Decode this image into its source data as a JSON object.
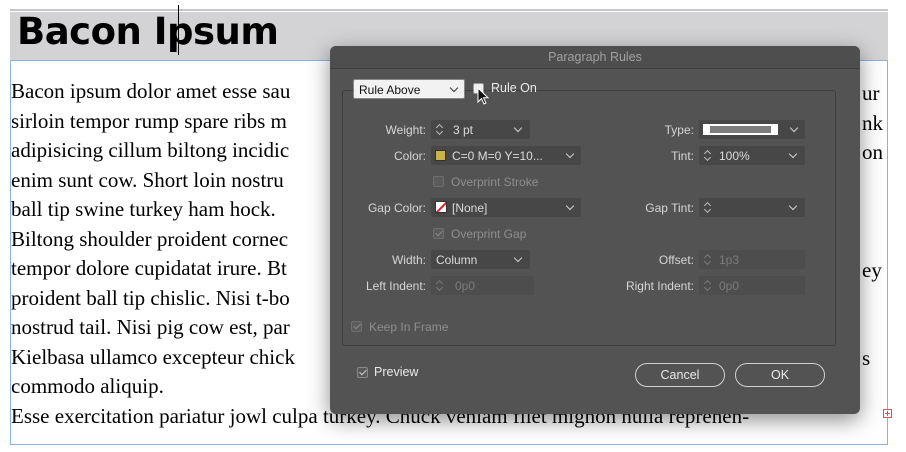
{
  "document": {
    "heading": "Bacon Ipsum",
    "lines": [
      "Bacon ipsum dolor amet esse sau",
      "sirloin tempor rump spare ribs m",
      "adipisicing cillum biltong incidic",
      "enim sunt cow. Short loin nostru",
      "ball tip swine turkey ham hock.",
      "Biltong shoulder proident cornec",
      "tempor dolore cupidatat irure. Bt",
      "proident ball tip chislic. Nisi t-bo",
      "nostrud tail. Nisi pig cow est, par",
      "Kielbasa ullamco excepteur chick",
      "commodo aliquip.",
      "Esse exercitation pariatur jowl culpa turkey. Chuck veniam filet mignon nulla reprehen-"
    ],
    "right_edge_fragments": [
      "ur",
      "nk",
      "on",
      "",
      "",
      "",
      "ey",
      "",
      "",
      "s",
      "",
      ""
    ]
  },
  "dialog": {
    "title": "Paragraph Rules",
    "rule_select": "Rule Above",
    "rule_on_label": "Rule On",
    "rule_on_checked": false,
    "labels": {
      "weight": "Weight:",
      "color": "Color:",
      "type": "Type:",
      "tint": "Tint:",
      "overprint_stroke": "Overprint Stroke",
      "gap_color": "Gap Color:",
      "gap_tint": "Gap Tint:",
      "overprint_gap": "Overprint Gap",
      "width": "Width:",
      "offset": "Offset:",
      "left_indent": "Left Indent:",
      "right_indent": "Right Indent:",
      "keep_in_frame": "Keep In Frame",
      "preview": "Preview"
    },
    "values": {
      "weight": "3 pt",
      "color": "C=0 M=0 Y=10...",
      "tint": "100%",
      "gap_color": "[None]",
      "gap_tint": "",
      "width": "Column",
      "offset": "1p3",
      "left_indent": "0p0",
      "right_indent": "0p0"
    },
    "checks": {
      "overprint_stroke": false,
      "overprint_gap": true,
      "keep_in_frame": true,
      "preview": true
    },
    "buttons": {
      "cancel": "Cancel",
      "ok": "OK"
    },
    "colors": {
      "swatch": "#c8b44a",
      "dialog_bg": "#535353"
    }
  }
}
